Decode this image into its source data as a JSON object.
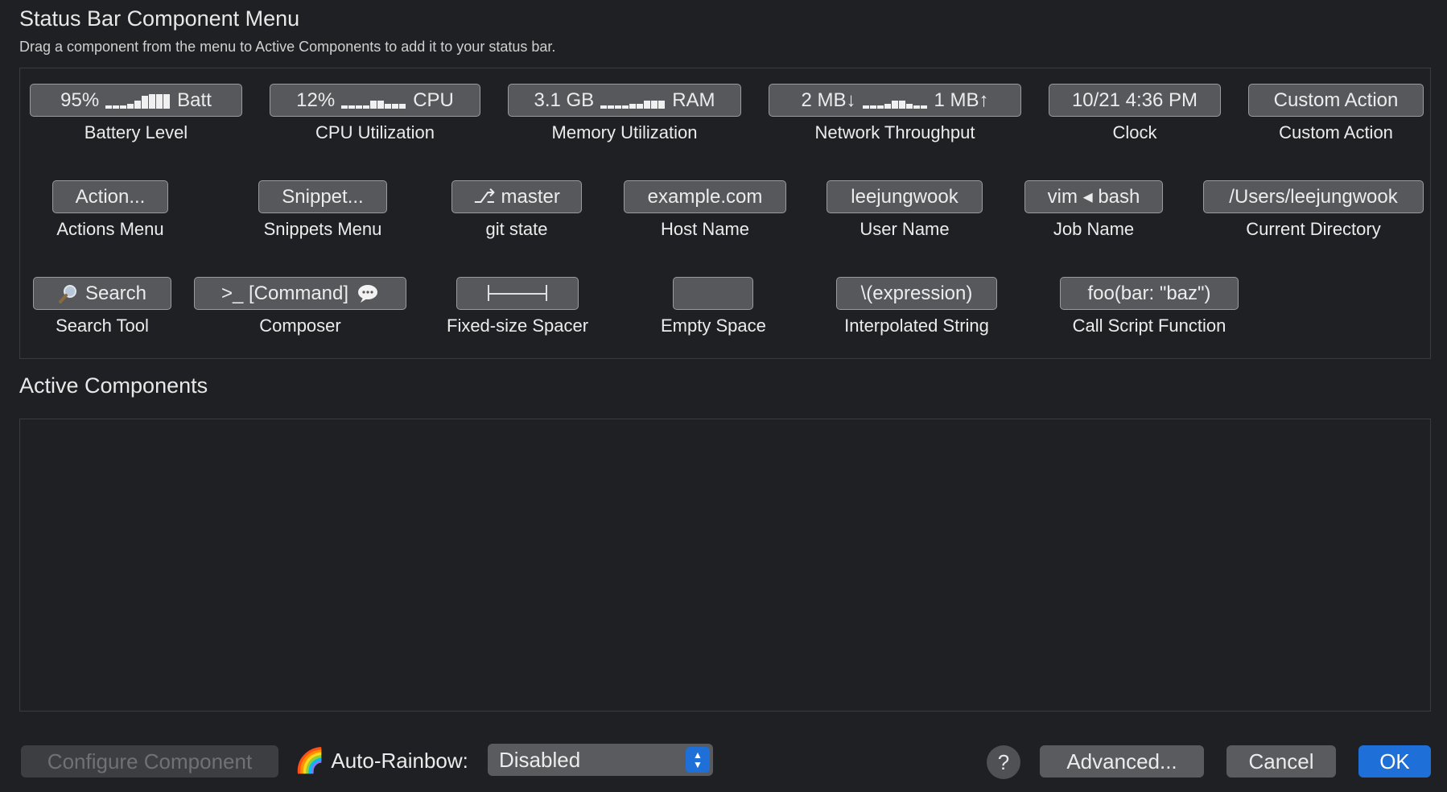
{
  "header": {
    "title": "Status Bar Component Menu",
    "subtitle": "Drag a component from the menu to Active Components to add it to your status bar."
  },
  "components": {
    "battery": {
      "pill_left": "95%",
      "pill_right": "Batt",
      "label": "Battery Level"
    },
    "cpu": {
      "pill_left": "12%",
      "pill_right": "CPU",
      "label": "CPU Utilization"
    },
    "memory": {
      "pill_left": "3.1 GB",
      "pill_right": "RAM",
      "label": "Memory Utilization"
    },
    "network": {
      "pill_left": "2 MB↓",
      "pill_right": "1 MB↑",
      "label": "Network Throughput"
    },
    "clock": {
      "pill": "10/21 4:36 PM",
      "label": "Clock"
    },
    "custom_action": {
      "pill": "Custom Action",
      "label": "Custom Action"
    },
    "actions_menu": {
      "pill": "Action...",
      "label": "Actions Menu"
    },
    "snippets_menu": {
      "pill": "Snippet...",
      "label": "Snippets Menu"
    },
    "git": {
      "pill": "⎇ master",
      "label": "git state"
    },
    "host": {
      "pill": "example.com",
      "label": "Host Name"
    },
    "user": {
      "pill": "leejungwook",
      "label": "User Name"
    },
    "job": {
      "pill": "vim ◂ bash",
      "label": "Job Name"
    },
    "directory": {
      "pill": "/Users/leejungwook",
      "label": "Current Directory"
    },
    "search": {
      "pill": "Search",
      "label": "Search Tool"
    },
    "composer": {
      "pill": ">_ [Command]",
      "label": "Composer"
    },
    "fixed_spacer": {
      "label": "Fixed-size Spacer"
    },
    "empty_space": {
      "label": "Empty Space"
    },
    "interpolated": {
      "pill": "\\(expression)",
      "label": "Interpolated String"
    },
    "script_function": {
      "pill": "foo(bar: \"baz\")",
      "label": "Call Script Function"
    }
  },
  "active": {
    "title": "Active Components"
  },
  "footer": {
    "configure": "Configure Component",
    "rainbow_label": "Auto-Rainbow:",
    "rainbow_value": "Disabled",
    "help": "?",
    "advanced": "Advanced...",
    "cancel": "Cancel",
    "ok": "OK"
  }
}
